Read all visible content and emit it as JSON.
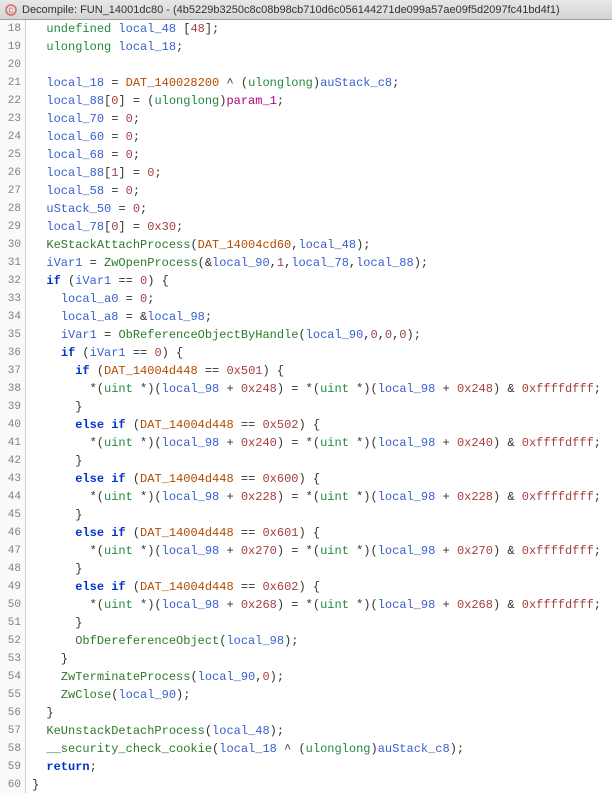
{
  "title": "Decompile: FUN_14001dc80 - (4b5229b3250c8c08b98cb710d6c056144271de099a57ae09f5d2097fc41bd4f1)",
  "icon_name": "decompile-icon",
  "lines": [
    {
      "n": 18,
      "tokens": [
        [
          "  ",
          "op"
        ],
        [
          "undefined",
          "type"
        ],
        [
          " ",
          "op"
        ],
        [
          "local_48",
          "var"
        ],
        [
          " [",
          "op"
        ],
        [
          "48",
          "num"
        ],
        [
          "];",
          "op"
        ]
      ]
    },
    {
      "n": 19,
      "tokens": [
        [
          "  ",
          "op"
        ],
        [
          "ulonglong",
          "type"
        ],
        [
          " ",
          "op"
        ],
        [
          "local_18",
          "var"
        ],
        [
          ";",
          "op"
        ]
      ]
    },
    {
      "n": 20,
      "tokens": [
        [
          "  ",
          "op"
        ]
      ]
    },
    {
      "n": 21,
      "tokens": [
        [
          "  ",
          "op"
        ],
        [
          "local_18",
          "var"
        ],
        [
          " = ",
          "op"
        ],
        [
          "DAT_140028200",
          "global"
        ],
        [
          " ^ (",
          "op"
        ],
        [
          "ulonglong",
          "type"
        ],
        [
          ")",
          "op"
        ],
        [
          "auStack_c8",
          "var"
        ],
        [
          ";",
          "op"
        ]
      ]
    },
    {
      "n": 22,
      "tokens": [
        [
          "  ",
          "op"
        ],
        [
          "local_88",
          "var"
        ],
        [
          "[",
          "op"
        ],
        [
          "0",
          "num"
        ],
        [
          "] = (",
          "op"
        ],
        [
          "ulonglong",
          "type"
        ],
        [
          ")",
          "op"
        ],
        [
          "param_1",
          "param"
        ],
        [
          ";",
          "op"
        ]
      ]
    },
    {
      "n": 23,
      "tokens": [
        [
          "  ",
          "op"
        ],
        [
          "local_70",
          "var"
        ],
        [
          " = ",
          "op"
        ],
        [
          "0",
          "num"
        ],
        [
          ";",
          "op"
        ]
      ]
    },
    {
      "n": 24,
      "tokens": [
        [
          "  ",
          "op"
        ],
        [
          "local_60",
          "var"
        ],
        [
          " = ",
          "op"
        ],
        [
          "0",
          "num"
        ],
        [
          ";",
          "op"
        ]
      ]
    },
    {
      "n": 25,
      "tokens": [
        [
          "  ",
          "op"
        ],
        [
          "local_68",
          "var"
        ],
        [
          " = ",
          "op"
        ],
        [
          "0",
          "num"
        ],
        [
          ";",
          "op"
        ]
      ]
    },
    {
      "n": 26,
      "tokens": [
        [
          "  ",
          "op"
        ],
        [
          "local_88",
          "var"
        ],
        [
          "[",
          "op"
        ],
        [
          "1",
          "num"
        ],
        [
          "] = ",
          "op"
        ],
        [
          "0",
          "num"
        ],
        [
          ";",
          "op"
        ]
      ]
    },
    {
      "n": 27,
      "tokens": [
        [
          "  ",
          "op"
        ],
        [
          "local_58",
          "var"
        ],
        [
          " = ",
          "op"
        ],
        [
          "0",
          "num"
        ],
        [
          ";",
          "op"
        ]
      ]
    },
    {
      "n": 28,
      "tokens": [
        [
          "  ",
          "op"
        ],
        [
          "uStack_50",
          "var"
        ],
        [
          " = ",
          "op"
        ],
        [
          "0",
          "num"
        ],
        [
          ";",
          "op"
        ]
      ]
    },
    {
      "n": 29,
      "tokens": [
        [
          "  ",
          "op"
        ],
        [
          "local_78",
          "var"
        ],
        [
          "[",
          "op"
        ],
        [
          "0",
          "num"
        ],
        [
          "] = ",
          "op"
        ],
        [
          "0x30",
          "num"
        ],
        [
          ";",
          "op"
        ]
      ]
    },
    {
      "n": 30,
      "tokens": [
        [
          "  ",
          "op"
        ],
        [
          "KeStackAttachProcess",
          "func"
        ],
        [
          "(",
          "op"
        ],
        [
          "DAT_14004cd60",
          "global"
        ],
        [
          ",",
          "op"
        ],
        [
          "local_48",
          "var"
        ],
        [
          ");",
          "op"
        ]
      ]
    },
    {
      "n": 31,
      "tokens": [
        [
          "  ",
          "op"
        ],
        [
          "iVar1",
          "var"
        ],
        [
          " = ",
          "op"
        ],
        [
          "ZwOpenProcess",
          "func"
        ],
        [
          "(&",
          "op"
        ],
        [
          "local_90",
          "var"
        ],
        [
          ",",
          "op"
        ],
        [
          "1",
          "num"
        ],
        [
          ",",
          "op"
        ],
        [
          "local_78",
          "var"
        ],
        [
          ",",
          "op"
        ],
        [
          "local_88",
          "var"
        ],
        [
          ");",
          "op"
        ]
      ]
    },
    {
      "n": 32,
      "tokens": [
        [
          "  ",
          "op"
        ],
        [
          "if",
          "keyword"
        ],
        [
          " (",
          "op"
        ],
        [
          "iVar1",
          "var"
        ],
        [
          " == ",
          "op"
        ],
        [
          "0",
          "num"
        ],
        [
          ") {",
          "brace"
        ]
      ]
    },
    {
      "n": 33,
      "tokens": [
        [
          "    ",
          "op"
        ],
        [
          "local_a0",
          "var"
        ],
        [
          " = ",
          "op"
        ],
        [
          "0",
          "num"
        ],
        [
          ";",
          "op"
        ]
      ]
    },
    {
      "n": 34,
      "tokens": [
        [
          "    ",
          "op"
        ],
        [
          "local_a8",
          "var"
        ],
        [
          " = &",
          "op"
        ],
        [
          "local_98",
          "var"
        ],
        [
          ";",
          "op"
        ]
      ]
    },
    {
      "n": 35,
      "tokens": [
        [
          "    ",
          "op"
        ],
        [
          "iVar1",
          "var"
        ],
        [
          " = ",
          "op"
        ],
        [
          "ObReferenceObjectByHandle",
          "func"
        ],
        [
          "(",
          "op"
        ],
        [
          "local_90",
          "var"
        ],
        [
          ",",
          "op"
        ],
        [
          "0",
          "num"
        ],
        [
          ",",
          "op"
        ],
        [
          "0",
          "num"
        ],
        [
          ",",
          "op"
        ],
        [
          "0",
          "num"
        ],
        [
          ");",
          "op"
        ]
      ]
    },
    {
      "n": 36,
      "tokens": [
        [
          "    ",
          "op"
        ],
        [
          "if",
          "keyword"
        ],
        [
          " (",
          "op"
        ],
        [
          "iVar1",
          "var"
        ],
        [
          " == ",
          "op"
        ],
        [
          "0",
          "num"
        ],
        [
          ") {",
          "brace"
        ]
      ]
    },
    {
      "n": 37,
      "tokens": [
        [
          "      ",
          "op"
        ],
        [
          "if",
          "keyword"
        ],
        [
          " (",
          "op"
        ],
        [
          "DAT_14004d448",
          "global"
        ],
        [
          " == ",
          "op"
        ],
        [
          "0x501",
          "num"
        ],
        [
          ") {",
          "brace"
        ]
      ]
    },
    {
      "n": 38,
      "tokens": [
        [
          "        *(",
          "op"
        ],
        [
          "uint",
          "type"
        ],
        [
          " *)(",
          "op"
        ],
        [
          "local_98",
          "var"
        ],
        [
          " + ",
          "op"
        ],
        [
          "0x248",
          "num"
        ],
        [
          ") = *(",
          "op"
        ],
        [
          "uint",
          "type"
        ],
        [
          " *)(",
          "op"
        ],
        [
          "local_98",
          "var"
        ],
        [
          " + ",
          "op"
        ],
        [
          "0x248",
          "num"
        ],
        [
          ") & ",
          "op"
        ],
        [
          "0xffffdfff",
          "num"
        ],
        [
          ";",
          "op"
        ]
      ]
    },
    {
      "n": 39,
      "tokens": [
        [
          "      }",
          "brace"
        ]
      ]
    },
    {
      "n": 40,
      "tokens": [
        [
          "      ",
          "op"
        ],
        [
          "else if",
          "keyword"
        ],
        [
          " (",
          "op"
        ],
        [
          "DAT_14004d448",
          "global"
        ],
        [
          " == ",
          "op"
        ],
        [
          "0x502",
          "num"
        ],
        [
          ") {",
          "brace"
        ]
      ]
    },
    {
      "n": 41,
      "tokens": [
        [
          "        *(",
          "op"
        ],
        [
          "uint",
          "type"
        ],
        [
          " *)(",
          "op"
        ],
        [
          "local_98",
          "var"
        ],
        [
          " + ",
          "op"
        ],
        [
          "0x240",
          "num"
        ],
        [
          ") = *(",
          "op"
        ],
        [
          "uint",
          "type"
        ],
        [
          " *)(",
          "op"
        ],
        [
          "local_98",
          "var"
        ],
        [
          " + ",
          "op"
        ],
        [
          "0x240",
          "num"
        ],
        [
          ") & ",
          "op"
        ],
        [
          "0xffffdfff",
          "num"
        ],
        [
          ";",
          "op"
        ]
      ]
    },
    {
      "n": 42,
      "tokens": [
        [
          "      }",
          "brace"
        ]
      ]
    },
    {
      "n": 43,
      "tokens": [
        [
          "      ",
          "op"
        ],
        [
          "else if",
          "keyword"
        ],
        [
          " (",
          "op"
        ],
        [
          "DAT_14004d448",
          "global"
        ],
        [
          " == ",
          "op"
        ],
        [
          "0x600",
          "num"
        ],
        [
          ") {",
          "brace"
        ]
      ]
    },
    {
      "n": 44,
      "tokens": [
        [
          "        *(",
          "op"
        ],
        [
          "uint",
          "type"
        ],
        [
          " *)(",
          "op"
        ],
        [
          "local_98",
          "var"
        ],
        [
          " + ",
          "op"
        ],
        [
          "0x228",
          "num"
        ],
        [
          ") = *(",
          "op"
        ],
        [
          "uint",
          "type"
        ],
        [
          " *)(",
          "op"
        ],
        [
          "local_98",
          "var"
        ],
        [
          " + ",
          "op"
        ],
        [
          "0x228",
          "num"
        ],
        [
          ") & ",
          "op"
        ],
        [
          "0xffffdfff",
          "num"
        ],
        [
          ";",
          "op"
        ]
      ]
    },
    {
      "n": 45,
      "tokens": [
        [
          "      }",
          "brace"
        ]
      ]
    },
    {
      "n": 46,
      "tokens": [
        [
          "      ",
          "op"
        ],
        [
          "else if",
          "keyword"
        ],
        [
          " (",
          "op"
        ],
        [
          "DAT_14004d448",
          "global"
        ],
        [
          " == ",
          "op"
        ],
        [
          "0x601",
          "num"
        ],
        [
          ") {",
          "brace"
        ]
      ]
    },
    {
      "n": 47,
      "tokens": [
        [
          "        *(",
          "op"
        ],
        [
          "uint",
          "type"
        ],
        [
          " *)(",
          "op"
        ],
        [
          "local_98",
          "var"
        ],
        [
          " + ",
          "op"
        ],
        [
          "0x270",
          "num"
        ],
        [
          ") = *(",
          "op"
        ],
        [
          "uint",
          "type"
        ],
        [
          " *)(",
          "op"
        ],
        [
          "local_98",
          "var"
        ],
        [
          " + ",
          "op"
        ],
        [
          "0x270",
          "num"
        ],
        [
          ") & ",
          "op"
        ],
        [
          "0xffffdfff",
          "num"
        ],
        [
          ";",
          "op"
        ]
      ]
    },
    {
      "n": 48,
      "tokens": [
        [
          "      }",
          "brace"
        ]
      ]
    },
    {
      "n": 49,
      "tokens": [
        [
          "      ",
          "op"
        ],
        [
          "else if",
          "keyword"
        ],
        [
          " (",
          "op"
        ],
        [
          "DAT_14004d448",
          "global"
        ],
        [
          " == ",
          "op"
        ],
        [
          "0x602",
          "num"
        ],
        [
          ") {",
          "brace"
        ]
      ]
    },
    {
      "n": 50,
      "tokens": [
        [
          "        *(",
          "op"
        ],
        [
          "uint",
          "type"
        ],
        [
          " *)(",
          "op"
        ],
        [
          "local_98",
          "var"
        ],
        [
          " + ",
          "op"
        ],
        [
          "0x268",
          "num"
        ],
        [
          ") = *(",
          "op"
        ],
        [
          "uint",
          "type"
        ],
        [
          " *)(",
          "op"
        ],
        [
          "local_98",
          "var"
        ],
        [
          " + ",
          "op"
        ],
        [
          "0x268",
          "num"
        ],
        [
          ") & ",
          "op"
        ],
        [
          "0xffffdfff",
          "num"
        ],
        [
          ";",
          "op"
        ]
      ]
    },
    {
      "n": 51,
      "tokens": [
        [
          "      }",
          "brace"
        ]
      ]
    },
    {
      "n": 52,
      "tokens": [
        [
          "      ",
          "op"
        ],
        [
          "ObfDereferenceObject",
          "func"
        ],
        [
          "(",
          "op"
        ],
        [
          "local_98",
          "var"
        ],
        [
          ");",
          "op"
        ]
      ]
    },
    {
      "n": 53,
      "tokens": [
        [
          "    }",
          "brace"
        ]
      ]
    },
    {
      "n": 54,
      "tokens": [
        [
          "    ",
          "op"
        ],
        [
          "ZwTerminateProcess",
          "func"
        ],
        [
          "(",
          "op"
        ],
        [
          "local_90",
          "var"
        ],
        [
          ",",
          "op"
        ],
        [
          "0",
          "num"
        ],
        [
          ");",
          "op"
        ]
      ]
    },
    {
      "n": 55,
      "tokens": [
        [
          "    ",
          "op"
        ],
        [
          "ZwClose",
          "func"
        ],
        [
          "(",
          "op"
        ],
        [
          "local_90",
          "var"
        ],
        [
          ");",
          "op"
        ]
      ]
    },
    {
      "n": 56,
      "tokens": [
        [
          "  }",
          "brace"
        ]
      ]
    },
    {
      "n": 57,
      "tokens": [
        [
          "  ",
          "op"
        ],
        [
          "KeUnstackDetachProcess",
          "func"
        ],
        [
          "(",
          "op"
        ],
        [
          "local_48",
          "var"
        ],
        [
          ");",
          "op"
        ]
      ]
    },
    {
      "n": 58,
      "tokens": [
        [
          "  ",
          "op"
        ],
        [
          "__security_check_cookie",
          "func"
        ],
        [
          "(",
          "op"
        ],
        [
          "local_18",
          "var"
        ],
        [
          " ^ (",
          "op"
        ],
        [
          "ulonglong",
          "type"
        ],
        [
          ")",
          "op"
        ],
        [
          "auStack_c8",
          "var"
        ],
        [
          ");",
          "op"
        ]
      ]
    },
    {
      "n": 59,
      "tokens": [
        [
          "  ",
          "op"
        ],
        [
          "return",
          "keyword"
        ],
        [
          ";",
          "op"
        ]
      ]
    },
    {
      "n": 60,
      "tokens": [
        [
          "}",
          "brace"
        ]
      ]
    }
  ]
}
